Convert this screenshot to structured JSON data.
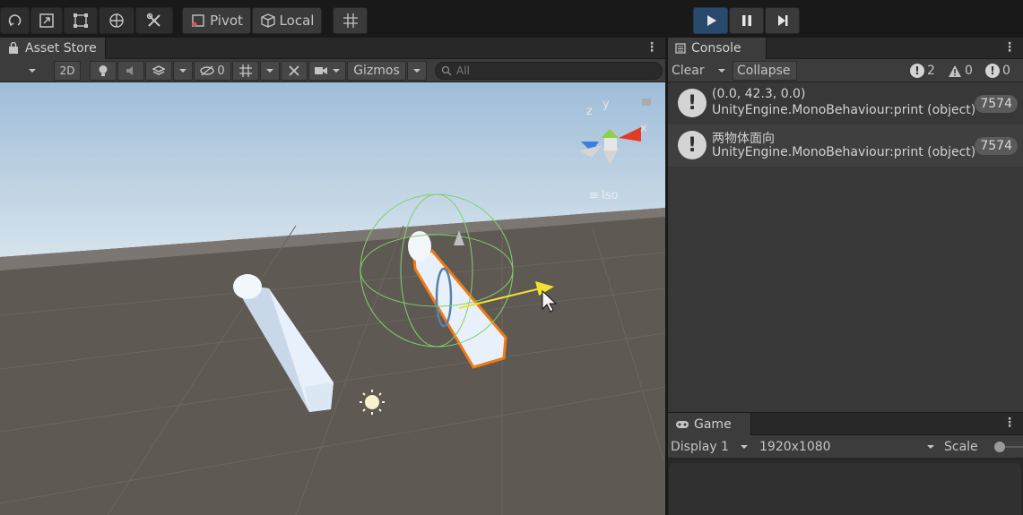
{
  "toolbar": {
    "pivot_label": "Pivot",
    "local_label": "Local"
  },
  "scene": {
    "tab_label": "Asset Store",
    "mode_2d": "2D",
    "hidden_count": "0",
    "gizmos_label": "Gizmos",
    "search_placeholder": "All",
    "iso_label": "Iso",
    "gizmo_axes": {
      "x": "x",
      "y": "y",
      "z": "z"
    }
  },
  "console": {
    "tab_label": "Console",
    "clear_label": "Clear",
    "collapse_label": "Collapse",
    "error_count": "2",
    "warning_count": "0",
    "info_count": "0",
    "entries": [
      {
        "line1": "(0.0, 42.3, 0.0)",
        "line2": "UnityEngine.MonoBehaviour:print (object)",
        "count": "7574"
      },
      {
        "line1": "两物体面向",
        "line2": "UnityEngine.MonoBehaviour:print (object)",
        "count": "7574"
      }
    ]
  },
  "game": {
    "tab_label": "Game",
    "display_label": "Display 1",
    "resolution_label": "1920x1080",
    "scale_label": "Scale"
  },
  "colors": {
    "play_active": "#2a4a6b",
    "selection_outline": "#f07a14",
    "rotate_gizmo": "#7fd06a",
    "direction_arrow": "#f0e030"
  }
}
